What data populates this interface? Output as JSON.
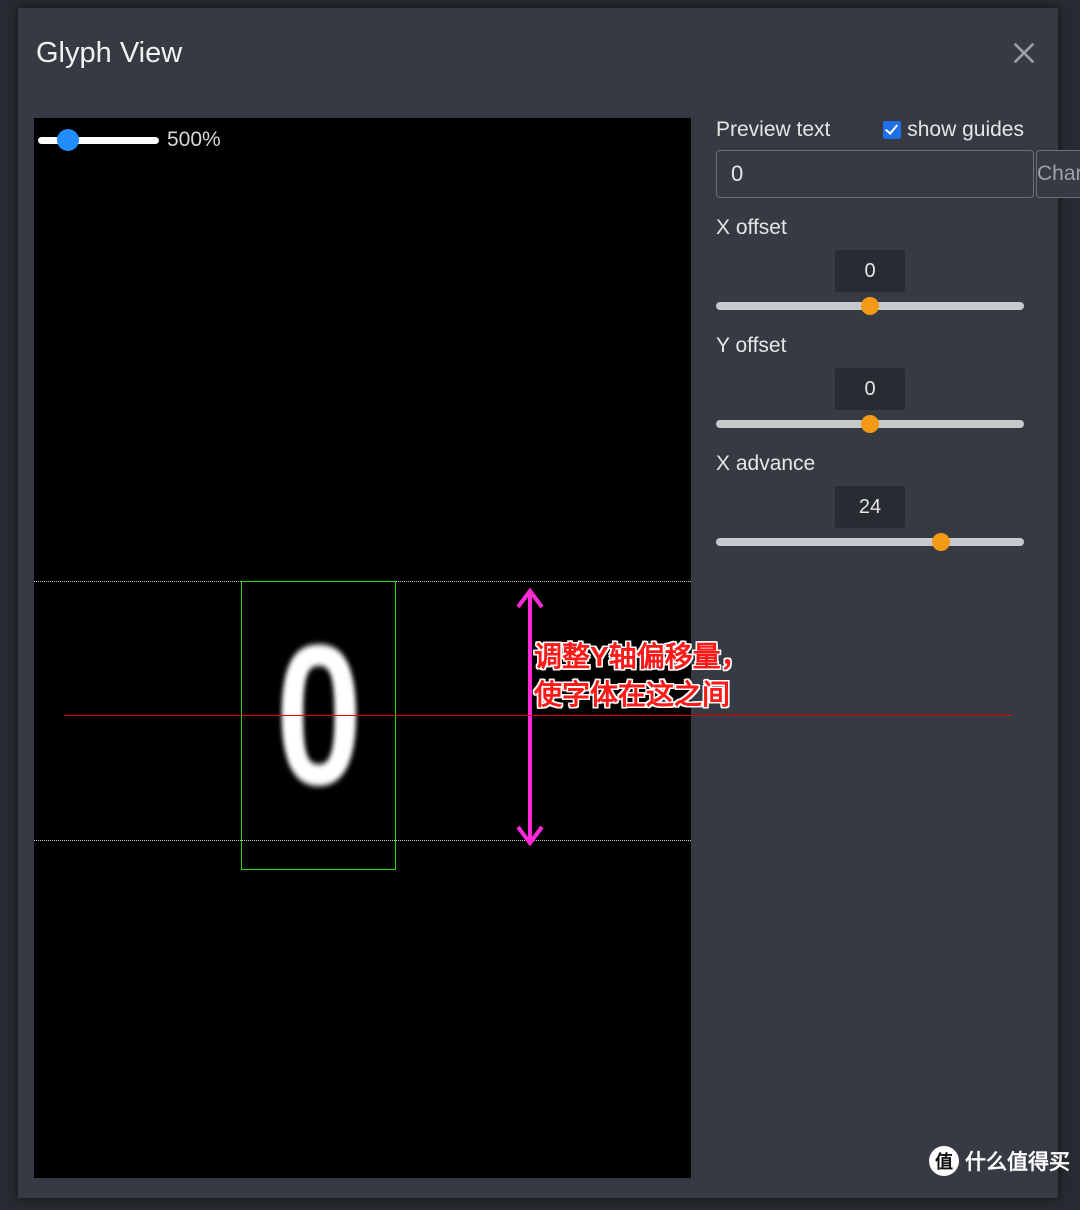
{
  "modal": {
    "title": "Glyph View"
  },
  "zoom": {
    "percent_label": "500%",
    "thumb_percent": 25
  },
  "annotation": {
    "line1": "调整Y轴偏移量，",
    "line2": "使字体在这之间"
  },
  "glyph": {
    "char": "0"
  },
  "panel": {
    "preview_label": "Preview text",
    "show_guides_label": "show guides",
    "show_guides_checked": true,
    "preview_value": "0",
    "dropdown_label": "Characters",
    "controls": [
      {
        "label": "X offset",
        "value": "0",
        "thumb_percent": 50
      },
      {
        "label": "Y offset",
        "value": "0",
        "thumb_percent": 50
      },
      {
        "label": "X advance",
        "value": "24",
        "thumb_percent": 73
      }
    ]
  },
  "watermark": {
    "badge": "值",
    "text": "什么值得买"
  }
}
